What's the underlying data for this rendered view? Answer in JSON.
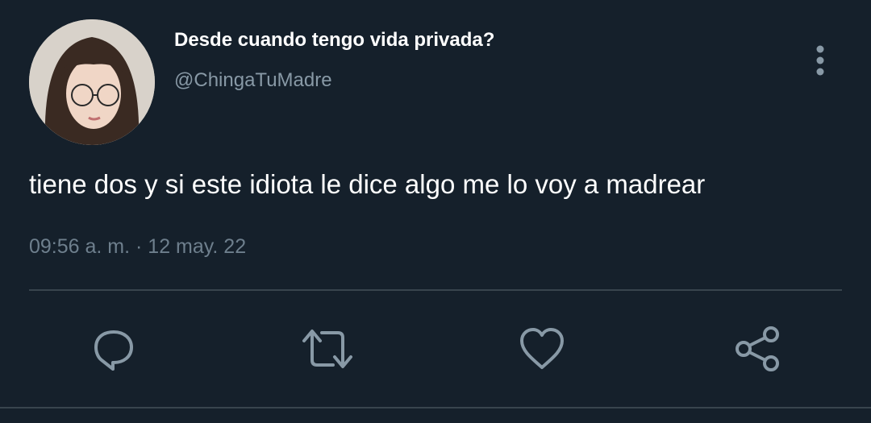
{
  "tweet": {
    "display_name": "Desde cuando tengo vida privada?",
    "handle": "@ChingaTuMadre",
    "text": "tiene dos y si este idiota le dice algo me lo voy a madrear",
    "timestamp": "09:56 a. m. · 12 may. 22"
  },
  "icons": {
    "more": "more-vertical-icon",
    "reply": "reply-icon",
    "retweet": "retweet-icon",
    "like": "heart-icon",
    "share": "share-icon"
  },
  "colors": {
    "background": "#15202b",
    "primary_text": "#ffffff",
    "secondary_text": "#8899a6",
    "icon": "#8899a6",
    "divider": "#38444d"
  }
}
